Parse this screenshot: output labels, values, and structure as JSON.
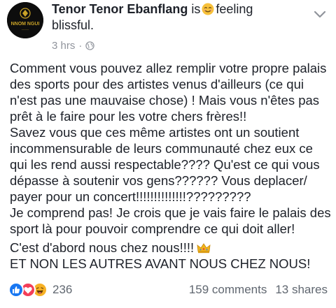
{
  "post": {
    "author": "Tenor Tenor Ebanflang",
    "activity_prefix": "is",
    "activity": "feeling blissful.",
    "avatar_text": "NNOM NGUI",
    "time": "3 hrs",
    "separator": "·",
    "privacy_icon": "globe-icon",
    "paragraphs": [
      "Comment vous pouvez allez remplir votre propre palais des sports pour des artistes venus d'ailleurs (ce qui n'est pas une mauvaise chose) ! Mais vous n'êtes pas prêt à le faire pour les votre chers frères!!",
      "Savez vous que ces même artistes ont un soutient incommensurable de leurs communauté chez eux ce qui les rend aussi respectable???? Qu'est ce qui vous dépasse à soutenir vos gens?????? Vous deplacer/ payer pour un concert!!!!!!!!!!!!!!?????????",
      "Je comprend pas! Je crois que je vais faire le palais des sport là pour pouvoir comprendre ce qui doit aller!"
    ],
    "closing_line": "C'est d'abord nous chez nous!!!!",
    "closing_caps": "ET NON LES AUTRES AVANT NOUS CHEZ NOUS!"
  },
  "footer": {
    "reaction_count": "236",
    "comments": "159 comments",
    "shares": "13 shares"
  },
  "colors": {
    "text": "#1d2129",
    "meta": "#90949c",
    "like": "#1877f2",
    "love": "#f33e58",
    "haha": "#f7b125"
  }
}
